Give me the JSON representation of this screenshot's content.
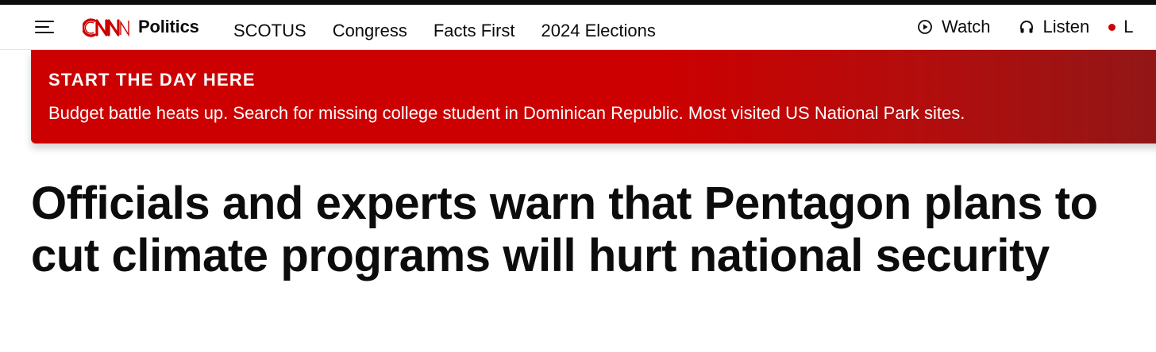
{
  "header": {
    "menu_icon": "hamburger-menu-icon",
    "logo_icon": "cnn-logo",
    "brand_color": "#cc0000",
    "section": "Politics",
    "nav_links": [
      {
        "label": "SCOTUS"
      },
      {
        "label": "Congress"
      },
      {
        "label": "Facts First"
      },
      {
        "label": "2024 Elections"
      }
    ],
    "watch": {
      "label": "Watch",
      "icon": "play-circle-icon"
    },
    "listen": {
      "label": "Listen",
      "icon": "headphones-icon"
    },
    "live": {
      "icon": "live-dot-icon",
      "label_partial": "L"
    }
  },
  "banner": {
    "title": "START THE DAY HERE",
    "text": "Budget battle heats up. Search for missing college student in Dominican Republic. Most visited US National Park sites."
  },
  "article": {
    "headline": "Officials and experts warn that Pentagon plans to cut climate programs will hurt national security"
  }
}
